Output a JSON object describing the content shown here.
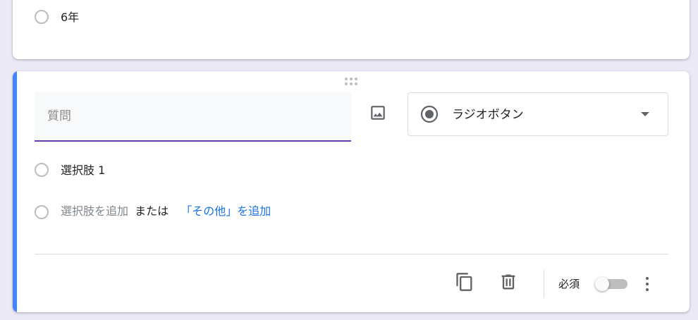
{
  "previous_question": {
    "option_label": "6年"
  },
  "question": {
    "title_value": "",
    "title_placeholder": "質問",
    "type_label": "ラジオボタン",
    "options": [
      {
        "label": "選択肢 1"
      }
    ],
    "add_option_label": "選択肢を追加",
    "or_label": "または",
    "add_other_label": "「その他」を追加"
  },
  "footer": {
    "required_label": "必須",
    "required_on": false
  },
  "icons": {
    "drag": "drag-handle-icon",
    "image": "image-icon",
    "type": "radio-button-icon",
    "dropdown": "dropdown-arrow-icon",
    "copy": "copy-icon",
    "delete": "trash-icon",
    "more": "more-vert-icon"
  },
  "colors": {
    "background": "#ece9f7",
    "accent": "#673ab7",
    "active_bar": "#4285f4",
    "link": "#1a73e8"
  }
}
